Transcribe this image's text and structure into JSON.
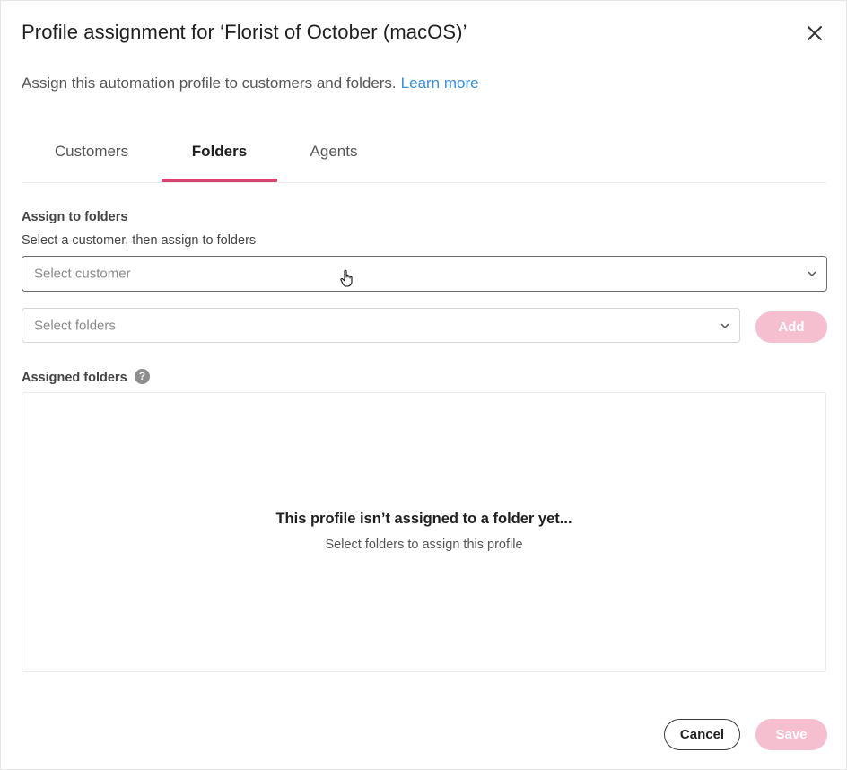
{
  "dialog": {
    "title": "Profile assignment for ‘Florist of October (macOS)’",
    "subtitle": "Assign this automation profile to customers and folders.",
    "learn_more": "Learn more"
  },
  "tabs": [
    {
      "label": "Customers",
      "active": false
    },
    {
      "label": "Folders",
      "active": true
    },
    {
      "label": "Agents",
      "active": false
    }
  ],
  "assign": {
    "label": "Assign to folders",
    "helper": "Select a customer, then assign to folders",
    "customer_placeholder": "Select customer",
    "folders_placeholder": "Select folders",
    "add_label": "Add"
  },
  "assigned": {
    "label": "Assigned folders",
    "help_glyph": "?",
    "empty_title": "This profile isn’t assigned to a folder yet...",
    "empty_subtitle": "Select folders to assign this profile"
  },
  "footer": {
    "cancel_label": "Cancel",
    "save_label": "Save"
  },
  "colors": {
    "accent": "#d9426e",
    "disabled_button": "#f5bfd0",
    "link": "#3a8fd6"
  },
  "icons": {
    "close": "close-icon",
    "dropdown": "chevron-down-icon",
    "help": "help-circle-icon",
    "pointer": "hand-pointer-icon"
  }
}
